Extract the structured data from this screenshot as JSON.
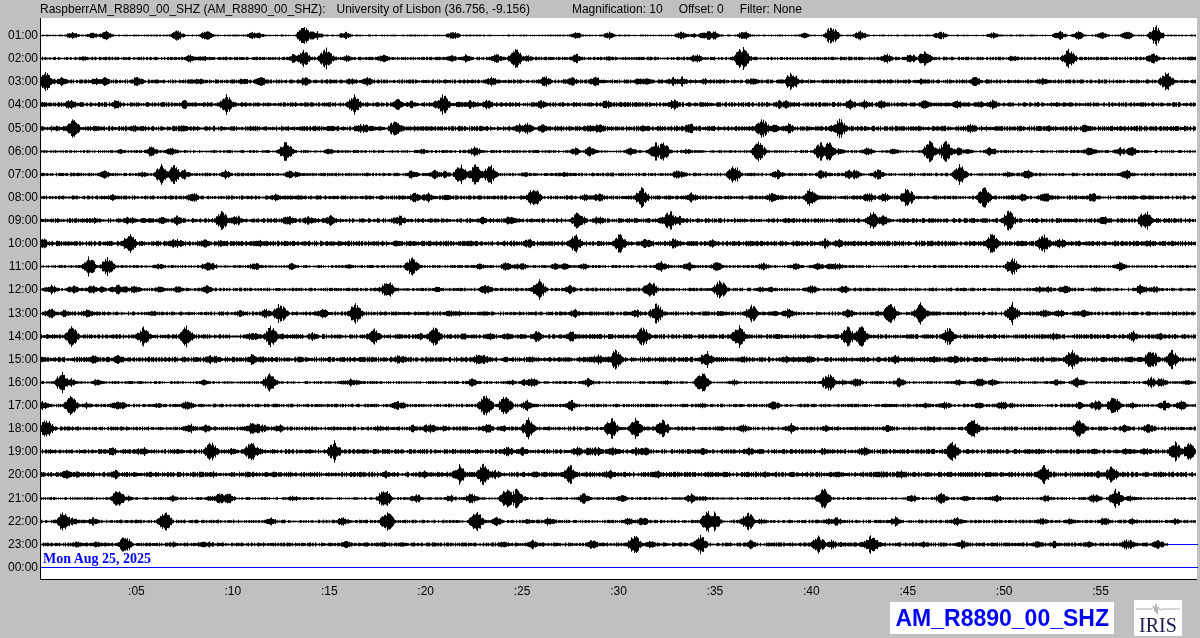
{
  "header": {
    "station": "RaspberrAM_R8890_00_SHZ (AM_R8890_00_SHZ):",
    "location": "University of Lisbon (36.756, -9.156)",
    "magnification": "Magnification: 10",
    "offset": "Offset: 0",
    "filter": "Filter: None"
  },
  "rows": [
    {
      "label": "01:00",
      "kind": "trace"
    },
    {
      "label": "02:00",
      "kind": "trace"
    },
    {
      "label": "03:00",
      "kind": "trace"
    },
    {
      "label": "04:00",
      "kind": "trace"
    },
    {
      "label": "05:00",
      "kind": "trace"
    },
    {
      "label": "06:00",
      "kind": "trace"
    },
    {
      "label": "07:00",
      "kind": "trace"
    },
    {
      "label": "08:00",
      "kind": "trace"
    },
    {
      "label": "09:00",
      "kind": "trace"
    },
    {
      "label": "10:00",
      "kind": "trace"
    },
    {
      "label": "11:00",
      "kind": "trace"
    },
    {
      "label": "12:00",
      "kind": "trace"
    },
    {
      "label": "13:00",
      "kind": "trace"
    },
    {
      "label": "14:00",
      "kind": "trace"
    },
    {
      "label": "15:00",
      "kind": "trace"
    },
    {
      "label": "16:00",
      "kind": "trace"
    },
    {
      "label": "17:00",
      "kind": "trace"
    },
    {
      "label": "18:00",
      "kind": "trace"
    },
    {
      "label": "19:00",
      "kind": "trace"
    },
    {
      "label": "20:00",
      "kind": "trace"
    },
    {
      "label": "21:00",
      "kind": "trace"
    },
    {
      "label": "22:00",
      "kind": "trace"
    },
    {
      "label": "23:00",
      "kind": "partial"
    },
    {
      "label": "00:00",
      "kind": "pending"
    }
  ],
  "date": "Mon Aug 25, 2025",
  "ticks": [
    ":05",
    ":10",
    ":15",
    ":20",
    ":25",
    ":30",
    ":35",
    ":40",
    ":45",
    ":50",
    ":55"
  ],
  "channel_label": "AM_R8890_00_SHZ",
  "logo_text": "IRIS"
}
